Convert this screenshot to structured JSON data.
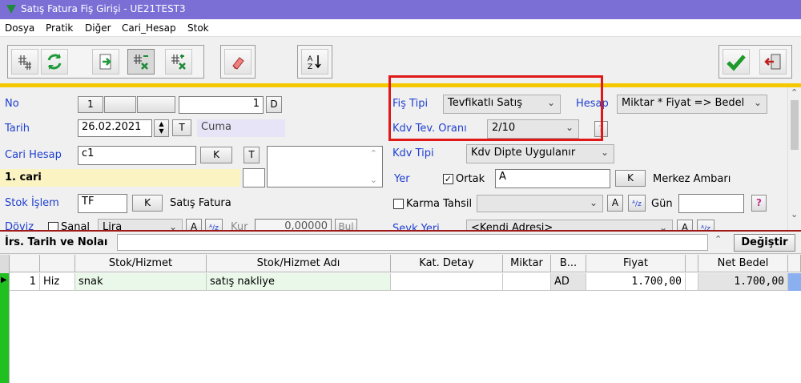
{
  "window": {
    "title": "Satış Fatura Fiş Girişi - UE21TEST3"
  },
  "menu": [
    "Dosya",
    "Pratik",
    "Diğer",
    "Cari_Hesap",
    "Stok"
  ],
  "toolbar": {
    "icons": [
      "add-rows-icon",
      "refresh-icon",
      "export-icon",
      "delete-column-icon",
      "delete-row-icon",
      "eraser-icon",
      "sort-az-icon",
      "ok-checkmark-icon",
      "exit-door-icon"
    ]
  },
  "form": {
    "no_label": "No",
    "no_field1": "1",
    "no_value": "1",
    "no_suffix": "D",
    "tarih_label": "Tarih",
    "tarih_value": "26.02.2021",
    "tarih_t": "T",
    "day_name": "Cuma",
    "cari_label": "Cari Hesap",
    "cari_value": "c1",
    "cari_k": "K",
    "cari_t": "T",
    "cari_name": "1. cari",
    "stok_label": "Stok İşlem",
    "stok_value": "TF",
    "stok_k": "K",
    "stok_desc": "Satış Fatura",
    "doviz_label": "Döviz",
    "sanal_label": "Sanal",
    "doviz_value": "Lira",
    "doviz_a": "A",
    "kur_label": "Kur",
    "kur_value": "0,00000",
    "bul_label": "Bul",
    "fis_tipi_label": "Fiş Tipi",
    "fis_tipi_value": "Tevfikatlı Satış",
    "hesap_label": "Hesap",
    "hesap_value": "Miktar * Fiyat => Bedel",
    "kdv_oran_label": "Kdv Tev. Oranı",
    "kdv_oran_value": "2/10",
    "kdv_tipi_label": "Kdv Tipi",
    "kdv_tipi_value": "Kdv Dipte Uygulanır",
    "yer_label": "Yer",
    "ortak_label": "Ortak",
    "yer_value": "A",
    "yer_k": "K",
    "yer_desc": "Merkez Ambarı",
    "karma_label": "Karma Tahsil",
    "karma_a": "A",
    "gun_label": "Gün",
    "sevk_label": "Sevk Yeri",
    "sevk_value": "<Kendi Adresi>",
    "sevk_a": "A",
    "help": "?"
  },
  "irs": {
    "label": "İrs. Tarih ve Nolaı",
    "value": "",
    "button": "Değiştir"
  },
  "grid": {
    "columns": [
      "",
      "Stok/Hizmet",
      "Stok/Hizmet Adı",
      "Kat. Detay",
      "Miktar",
      "B...",
      "Fiyat",
      "Net Bedel"
    ],
    "rows": [
      {
        "no": "1",
        "type": "Hiz",
        "code": "snak",
        "name": "satış nakliye",
        "kat": "",
        "miktar": "",
        "birim": "AD",
        "fiyat": "1.700,00",
        "net": "1.700,00"
      }
    ]
  },
  "colors": {
    "title_bg": "#7b6fd6",
    "accent_yellow": "#f5c800",
    "highlight_red": "#e01818",
    "label_blue": "#1f3fd0"
  }
}
